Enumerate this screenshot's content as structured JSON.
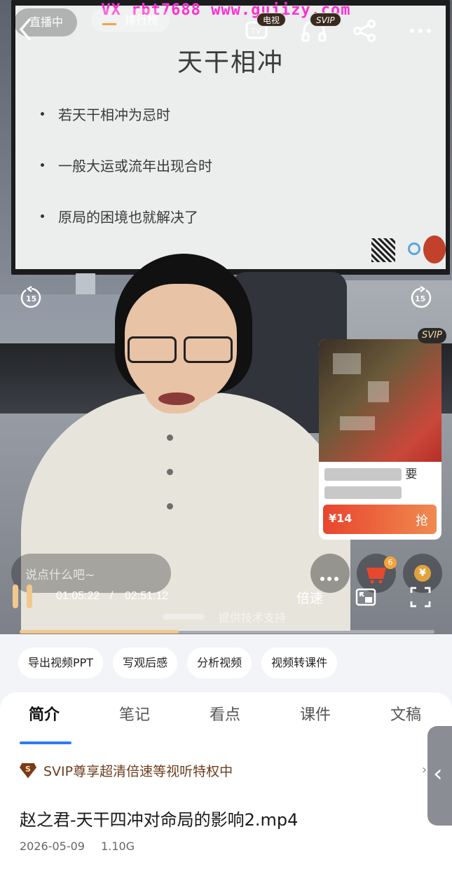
{
  "watermark": "VX rbt7688   www.gujizy.com",
  "topbar": {
    "live_label": "直播中",
    "rank_label": "排行榜",
    "tv_badge": "电视",
    "svip_badge": "SVIP"
  },
  "slide": {
    "title": "天干相冲",
    "bullets": [
      "若天干相冲为忌时",
      "一般大运或流年出现合时",
      "原局的困境也就解决了"
    ]
  },
  "product": {
    "svip_badge": "SVIP",
    "title_visible_char": "要",
    "price": "¥14",
    "buy_label": "抢"
  },
  "comment": {
    "placeholder": "说点什么吧~"
  },
  "cart": {
    "count": "6"
  },
  "coin": {
    "symbol": "¥"
  },
  "player": {
    "current_time": "01:05:22",
    "separator": "/",
    "total_time": "02:51:12",
    "speed_label": "倍速",
    "tech_support": "提供技术支持",
    "progress": 0.383
  },
  "actions": [
    "导出视频PPT",
    "写观后感",
    "分析视频",
    "视频转课件"
  ],
  "tabs": [
    "简介",
    "笔记",
    "看点",
    "课件",
    "文稿"
  ],
  "svip_banner": {
    "icon": "S",
    "text": "SVIP尊享超清倍速等视听特权中"
  },
  "file": {
    "title": "赵之君-天干四冲对命局的影响2.mp4",
    "date": "2026-05-09",
    "size": "1.10G"
  }
}
